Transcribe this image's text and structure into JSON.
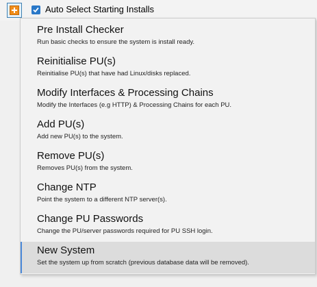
{
  "toolbar": {
    "add_icon": "plus-icon",
    "auto_select": {
      "label": "Auto Select Starting Installs",
      "checked": true
    }
  },
  "menu": {
    "items": [
      {
        "title": "Pre Install Checker",
        "description": "Run basic checks to ensure the system is install ready."
      },
      {
        "title": "Reinitialise PU(s)",
        "description": "Reinitialise PU(s) that have had Linux/disks replaced."
      },
      {
        "title": "Modify Interfaces & Processing Chains",
        "description": "Modify the Interfaces (e.g HTTP) & Processing Chains for each PU."
      },
      {
        "title": "Add PU(s)",
        "description": "Add new PU(s) to the system."
      },
      {
        "title": "Remove PU(s)",
        "description": "Removes PU(s) from the system."
      },
      {
        "title": "Change NTP",
        "description": "Point the system to a different NTP server(s)."
      },
      {
        "title": "Change PU Passwords",
        "description": "Change the PU/server passwords required for PU SSH login."
      },
      {
        "title": "New System",
        "description": "Set the system up from scratch (previous database data will be removed)."
      }
    ],
    "selected_index": 7
  },
  "colors": {
    "accent": "#4a88d8",
    "add_icon": "#f08c1a",
    "checkbox": "#2a78c8"
  }
}
